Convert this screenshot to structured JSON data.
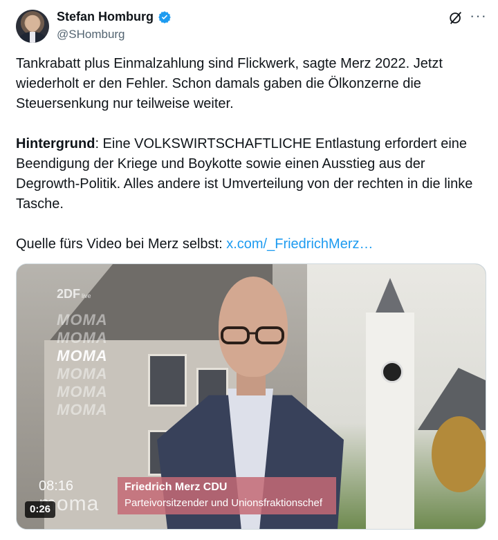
{
  "author": {
    "display_name": "Stefan Homburg",
    "handle": "@SHomburg",
    "verified": true
  },
  "header_actions": {
    "grok_icon": "grok-icon",
    "more_icon": "more-dots-icon",
    "more_label": "···"
  },
  "tweet": {
    "paragraph1": "Tankrabatt plus Einmalzahlung sind Flickwerk, sagte Merz 2022. Jetzt wiederholt er den Fehler. Schon damals gaben die Ölkonzerne die Steuersenkung nur teilweise weiter.",
    "paragraph2_bold": "Hintergrund",
    "paragraph2_rest": ": Eine VOLKSWIRTSCHAFTLICHE Entlastung erfordert eine Beendigung der Kriege und Boykotte sowie einen Ausstieg aus der Degrowth-Politik. Alles andere ist Umverteilung von der rechten in die linke Tasche.",
    "paragraph3_prefix": "Quelle fürs Video bei Merz selbst: ",
    "paragraph3_link": "x.com/_FriedrichMerz…"
  },
  "video": {
    "channel": "2DF",
    "channel_suffix": "live",
    "moma_repeat": [
      "MOMA",
      "MOMA",
      "MOMA",
      "MOMA",
      "MOMA",
      "MOMA"
    ],
    "clock_time": "08:16",
    "moma_logo": "moma",
    "lower_third_name": "Friedrich Merz  CDU",
    "lower_third_title": "Parteivorsitzender und Unionsfraktionschef",
    "duration": "0:26"
  },
  "colors": {
    "link": "#1d9bf0",
    "verified_badge": "#1d9bf0",
    "secondary_text": "#536471"
  }
}
